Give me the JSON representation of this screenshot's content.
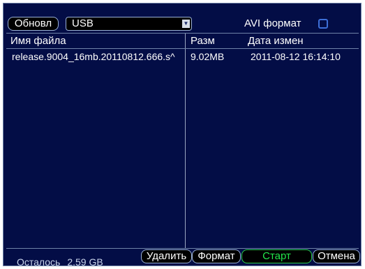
{
  "toolbar": {
    "refresh_label": "Обновл",
    "device_value": "USB",
    "avi_label": "AVI формат",
    "avi_checked": false
  },
  "table": {
    "columns": [
      "Имя файла",
      "Разм",
      "Дата измен"
    ],
    "rows": [
      {
        "name": "release.9004_16mb.20110812.666.s^",
        "size": "9.02MB",
        "date": "2011-08-12 16:14:10"
      }
    ]
  },
  "footer": {
    "remaining_label": "Осталось",
    "remaining_value": "2.59 GB",
    "delete_label": "Удалить",
    "format_label": "Формат",
    "start_label": "Старт",
    "cancel_label": "Отмена"
  },
  "colors": {
    "panel_bg": "#030d46",
    "start_text": "#22e64a",
    "checkbox": "#3d6fd8"
  },
  "icons": {
    "dropdown": "chevron-down-icon",
    "checkbox": "checkbox-icon"
  }
}
